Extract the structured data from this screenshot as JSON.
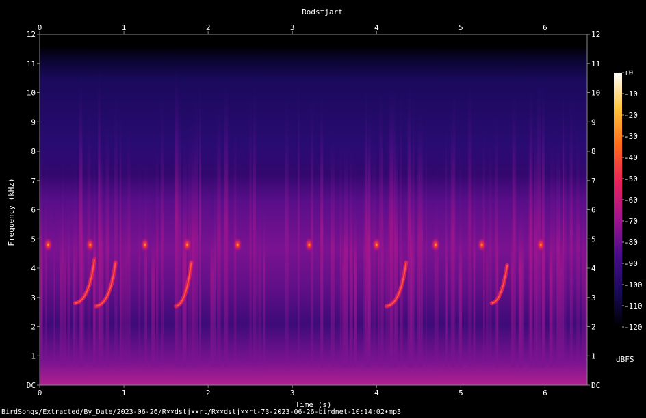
{
  "chart_data": {
    "type": "heatmap",
    "title": "Rodstjart",
    "xlabel": "Time (s)",
    "ylabel": "Frequency (kHz)",
    "xlim": [
      0,
      6.5
    ],
    "ylim": [
      0,
      12
    ],
    "x_ticks": [
      "0",
      "1",
      "2",
      "3",
      "4",
      "5",
      "6"
    ],
    "y_ticks": [
      "DC",
      "1",
      "2",
      "3",
      "4",
      "5",
      "6",
      "7",
      "8",
      "9",
      "10",
      "11",
      "12"
    ],
    "colorbar": {
      "label": "dBFS",
      "range": [
        -120,
        0
      ],
      "ticks": [
        "+0",
        "-10",
        "-20",
        "-30",
        "-40",
        "-50",
        "-60",
        "-70",
        "-80",
        "-90",
        "-100",
        "-110",
        "-120"
      ]
    },
    "grid": false,
    "colormap": [
      "#000000",
      "#1a0a5c",
      "#4a0c8c",
      "#a3148f",
      "#e8215a",
      "#ff6a1a",
      "#ffc43a",
      "#ffffff"
    ],
    "signal_band_khz": [
      0,
      11.6
    ],
    "calls": [
      {
        "t": 0.1,
        "f_khz": 4.8
      },
      {
        "t": 0.6,
        "f_khz": 4.8
      },
      {
        "t": 1.25,
        "f_khz": 4.8
      },
      {
        "t": 1.75,
        "f_khz": 4.8
      },
      {
        "t": 2.35,
        "f_khz": 4.8
      },
      {
        "t": 3.2,
        "f_khz": 4.8
      },
      {
        "t": 4.0,
        "f_khz": 4.8
      },
      {
        "t": 4.7,
        "f_khz": 4.8
      },
      {
        "t": 5.25,
        "f_khz": 4.8
      },
      {
        "t": 5.95,
        "f_khz": 4.8
      }
    ],
    "sweeps": [
      {
        "t_start": 0.45,
        "f_start": 2.8,
        "t_end": 0.65,
        "f_end": 4.3
      },
      {
        "t_start": 0.7,
        "f_start": 2.7,
        "t_end": 0.9,
        "f_end": 4.2
      },
      {
        "t_start": 1.65,
        "f_start": 2.7,
        "t_end": 1.8,
        "f_end": 4.2
      },
      {
        "t_start": 4.15,
        "f_start": 2.7,
        "t_end": 4.35,
        "f_end": 4.2
      },
      {
        "t_start": 5.4,
        "f_start": 2.8,
        "t_end": 5.55,
        "f_end": 4.1
      }
    ]
  },
  "footer": {
    "path": "BirdSongs/Extracted/By_Date/2023-06-26/R××dstj××rt/R××dstj××rt-73-2023-06-26-birdnet-10:14:02•mp3"
  }
}
